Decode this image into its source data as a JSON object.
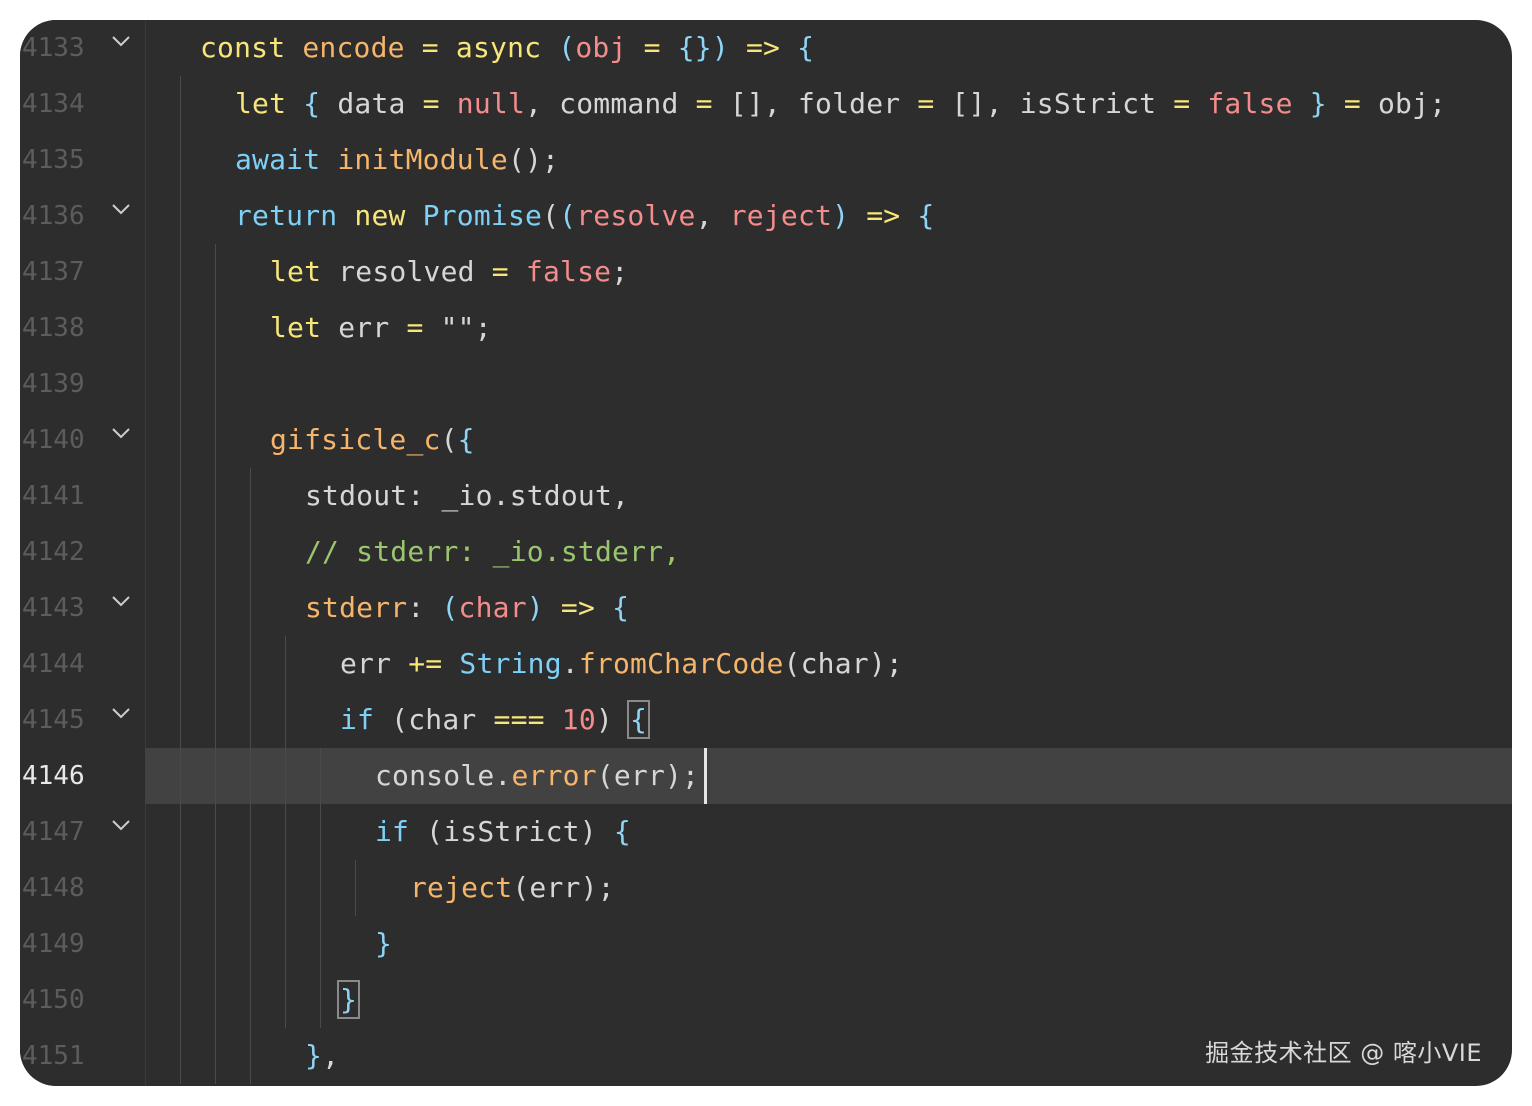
{
  "editor": {
    "current_line": 4146,
    "lines": [
      {
        "num": "4133",
        "fold": true,
        "tokens": [
          [
            "kw",
            "const"
          ],
          [
            "txt",
            " "
          ],
          [
            "fn",
            "encode"
          ],
          [
            "txt",
            " "
          ],
          [
            "op",
            "="
          ],
          [
            "txt",
            " "
          ],
          [
            "kw",
            "async"
          ],
          [
            "txt",
            " "
          ],
          [
            "br",
            "("
          ],
          [
            "par",
            "obj"
          ],
          [
            "txt",
            " "
          ],
          [
            "op",
            "="
          ],
          [
            "txt",
            " "
          ],
          [
            "br",
            "{}"
          ],
          [
            "br",
            ")"
          ],
          [
            "txt",
            " "
          ],
          [
            "op",
            "=>"
          ],
          [
            "txt",
            " "
          ],
          [
            "br",
            "{"
          ]
        ]
      },
      {
        "num": "4134",
        "fold": false,
        "tokens": [
          [
            "kw",
            "let"
          ],
          [
            "txt",
            " "
          ],
          [
            "br",
            "{"
          ],
          [
            "txt",
            " data "
          ],
          [
            "op",
            "="
          ],
          [
            "txt",
            " "
          ],
          [
            "lit",
            "null"
          ],
          [
            "txt",
            ", command "
          ],
          [
            "op",
            "="
          ],
          [
            "txt",
            " [], folder "
          ],
          [
            "op",
            "="
          ],
          [
            "txt",
            " [], isStrict "
          ],
          [
            "op",
            "="
          ],
          [
            "txt",
            " "
          ],
          [
            "lit",
            "false"
          ],
          [
            "txt",
            " "
          ],
          [
            "br",
            "}"
          ],
          [
            "txt",
            " "
          ],
          [
            "op",
            "="
          ],
          [
            "txt",
            " obj;"
          ]
        ]
      },
      {
        "num": "4135",
        "fold": false,
        "tokens": [
          [
            "blue",
            "await"
          ],
          [
            "txt",
            " "
          ],
          [
            "fn",
            "initModule"
          ],
          [
            "txt",
            "();"
          ]
        ]
      },
      {
        "num": "4136",
        "fold": true,
        "tokens": [
          [
            "blue",
            "return"
          ],
          [
            "txt",
            " "
          ],
          [
            "kw",
            "new"
          ],
          [
            "txt",
            " "
          ],
          [
            "blue",
            "Promise"
          ],
          [
            "txt",
            "("
          ],
          [
            "br",
            "("
          ],
          [
            "par",
            "resolve"
          ],
          [
            "txt",
            ", "
          ],
          [
            "par",
            "reject"
          ],
          [
            "br",
            ")"
          ],
          [
            "txt",
            " "
          ],
          [
            "op",
            "=>"
          ],
          [
            "txt",
            " "
          ],
          [
            "br",
            "{"
          ]
        ]
      },
      {
        "num": "4137",
        "fold": false,
        "tokens": [
          [
            "kw",
            "let"
          ],
          [
            "txt",
            " resolved "
          ],
          [
            "op",
            "="
          ],
          [
            "txt",
            " "
          ],
          [
            "lit",
            "false"
          ],
          [
            "txt",
            ";"
          ]
        ]
      },
      {
        "num": "4138",
        "fold": false,
        "tokens": [
          [
            "kw",
            "let"
          ],
          [
            "txt",
            " err "
          ],
          [
            "op",
            "="
          ],
          [
            "txt",
            " "
          ],
          [
            "str",
            "\"\""
          ],
          [
            "txt",
            ";"
          ]
        ]
      },
      {
        "num": "4139",
        "fold": false,
        "tokens": []
      },
      {
        "num": "4140",
        "fold": true,
        "tokens": [
          [
            "fn",
            "gifsicle_c"
          ],
          [
            "txt",
            "("
          ],
          [
            "br",
            "{"
          ]
        ]
      },
      {
        "num": "4141",
        "fold": false,
        "tokens": [
          [
            "txt",
            "stdout: _io.stdout,"
          ]
        ]
      },
      {
        "num": "4142",
        "fold": false,
        "tokens": [
          [
            "cmt",
            "// stderr: _io.stderr,"
          ]
        ]
      },
      {
        "num": "4143",
        "fold": true,
        "tokens": [
          [
            "prop",
            "stderr"
          ],
          [
            "txt",
            ": "
          ],
          [
            "br",
            "("
          ],
          [
            "par",
            "char"
          ],
          [
            "br",
            ")"
          ],
          [
            "txt",
            " "
          ],
          [
            "op",
            "=>"
          ],
          [
            "txt",
            " "
          ],
          [
            "br",
            "{"
          ]
        ]
      },
      {
        "num": "4144",
        "fold": false,
        "tokens": [
          [
            "txt",
            "err "
          ],
          [
            "op",
            "+="
          ],
          [
            "txt",
            " "
          ],
          [
            "blue",
            "String"
          ],
          [
            "txt",
            "."
          ],
          [
            "fn",
            "fromCharCode"
          ],
          [
            "txt",
            "(char);"
          ]
        ]
      },
      {
        "num": "4145",
        "fold": true,
        "tokens": [
          [
            "blue",
            "if"
          ],
          [
            "txt",
            " (char "
          ],
          [
            "op",
            "==="
          ],
          [
            "txt",
            " "
          ],
          [
            "num",
            "10"
          ],
          [
            "txt",
            ") "
          ],
          [
            "brm",
            "{"
          ]
        ]
      },
      {
        "num": "4146",
        "fold": false,
        "tokens": [
          [
            "txt",
            "console."
          ],
          [
            "fn",
            "error"
          ],
          [
            "txt",
            "(err);"
          ]
        ]
      },
      {
        "num": "4147",
        "fold": true,
        "tokens": [
          [
            "blue",
            "if"
          ],
          [
            "txt",
            " (isStrict) "
          ],
          [
            "br",
            "{"
          ]
        ]
      },
      {
        "num": "4148",
        "fold": false,
        "tokens": [
          [
            "fn",
            "reject"
          ],
          [
            "txt",
            "(err);"
          ]
        ]
      },
      {
        "num": "4149",
        "fold": false,
        "tokens": [
          [
            "br",
            "}"
          ]
        ]
      },
      {
        "num": "4150",
        "fold": false,
        "tokens": [
          [
            "brm",
            "}"
          ]
        ]
      },
      {
        "num": "4151",
        "fold": false,
        "tokens": [
          [
            "br",
            "}"
          ],
          [
            "txt",
            ","
          ]
        ]
      }
    ]
  },
  "watermark": "掘金技术社区 @ 喀小VIE"
}
